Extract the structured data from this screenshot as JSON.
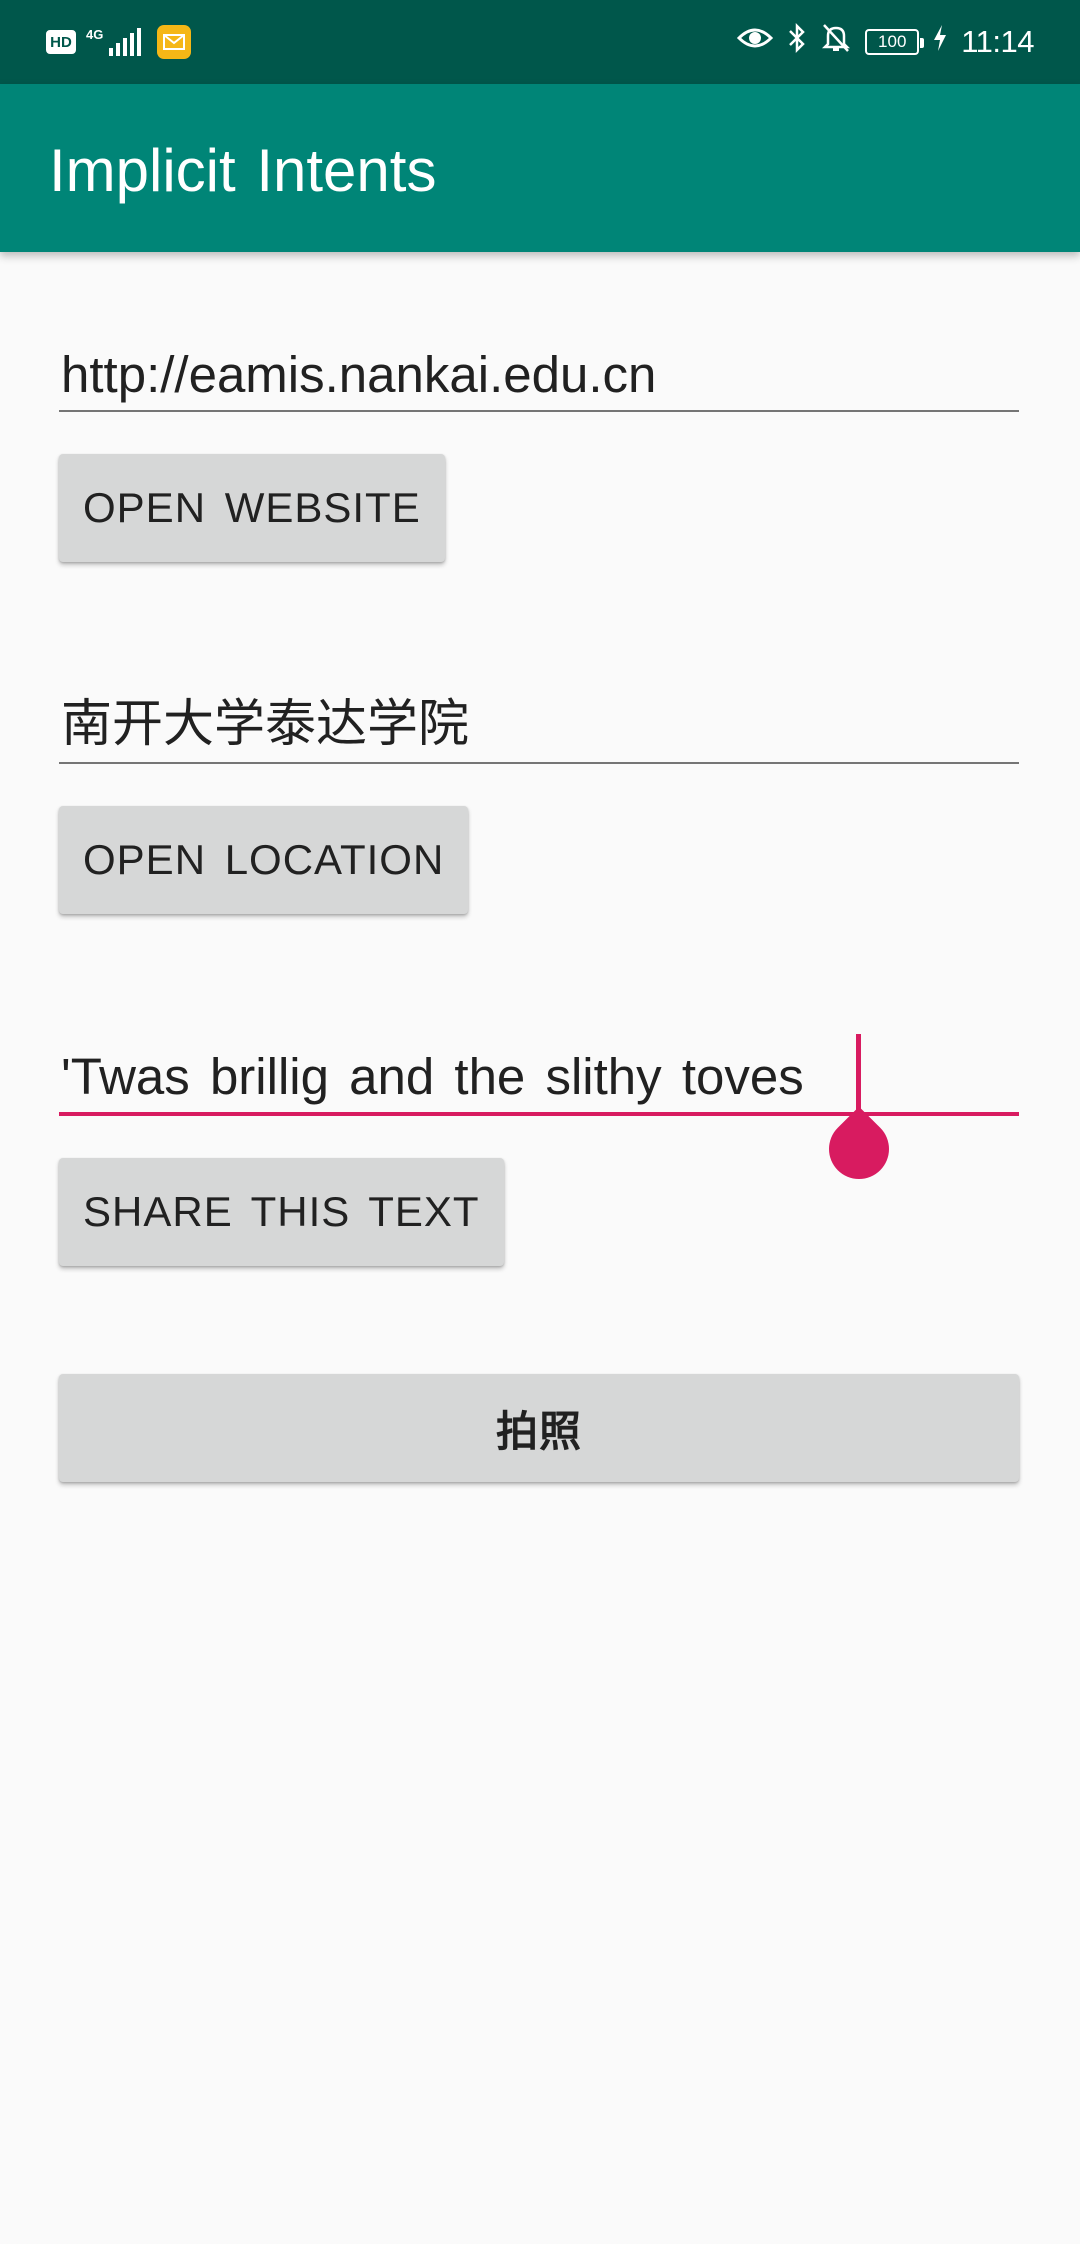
{
  "status_bar": {
    "hd": "HD",
    "network": "4G",
    "battery": "100",
    "time": "11:14",
    "icons": [
      "hd-icon",
      "signal-icon",
      "mail-icon",
      "eye-icon",
      "bluetooth-icon",
      "bell-off-icon",
      "battery-icon",
      "charging-icon"
    ]
  },
  "app_bar": {
    "title": "Implicit Intents"
  },
  "website": {
    "value": "http://eamis.nankai.edu.cn",
    "button_label": "OPEN WEBSITE"
  },
  "location": {
    "value": "南开大学泰达学院",
    "button_label": "OPEN LOCATION"
  },
  "share": {
    "value": "'Twas brillig and the slithy toves",
    "button_label": "SHARE THIS TEXT"
  },
  "camera": {
    "button_label": "拍照"
  },
  "colors": {
    "status_bar": "#00574b",
    "app_bar": "#008577",
    "accent": "#d81b60",
    "button": "#d6d7d7",
    "background": "#fafafa"
  }
}
